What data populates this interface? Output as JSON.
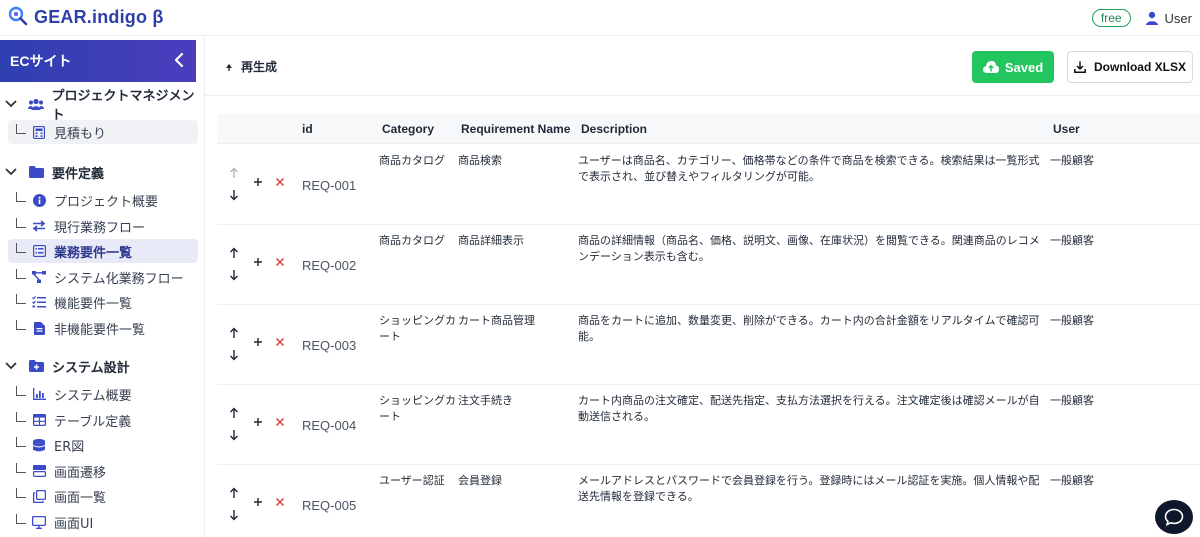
{
  "app": {
    "title": "GEAR.indigo β",
    "badge": "free",
    "user": "User"
  },
  "sidebar": {
    "title": "ECサイト",
    "sections": [
      {
        "label": "プロジェクトマネジメント",
        "icon": "users-icon",
        "items": [
          {
            "label": "見積もり",
            "icon": "calculator-icon"
          }
        ]
      },
      {
        "label": "要件定義",
        "icon": "folder-icon",
        "items": [
          {
            "label": "プロジェクト概要",
            "icon": "info-icon"
          },
          {
            "label": "現行業務フロー",
            "icon": "exchange-icon"
          },
          {
            "label": "業務要件一覧",
            "icon": "list-icon",
            "active": true
          },
          {
            "label": "システム化業務フロー",
            "icon": "flow-icon"
          },
          {
            "label": "機能要件一覧",
            "icon": "checklist-icon"
          },
          {
            "label": "非機能要件一覧",
            "icon": "file-icon"
          }
        ]
      },
      {
        "label": "システム設計",
        "icon": "folder-plus-icon",
        "items": [
          {
            "label": "システム概要",
            "icon": "chart-icon"
          },
          {
            "label": "テーブル定義",
            "icon": "table-icon"
          },
          {
            "label": "ER図",
            "icon": "database-icon"
          },
          {
            "label": "画面遷移",
            "icon": "screens-icon"
          },
          {
            "label": "画面一覧",
            "icon": "copy-icon"
          },
          {
            "label": "画面UI",
            "icon": "monitor-icon"
          }
        ]
      }
    ]
  },
  "toolbar": {
    "regenerate": "再生成",
    "saved": "Saved",
    "download": "Download XLSX"
  },
  "table": {
    "headers": {
      "id": "id",
      "category": "Category",
      "name": "Requirement Name",
      "description": "Description",
      "user": "User"
    },
    "rows": [
      {
        "id": "REQ-001",
        "category": "商品カタログ",
        "name": "商品検索",
        "description": "ユーザーは商品名、カテゴリー、価格帯などの条件で商品を検索できる。検索結果は一覧形式で表示され、並び替えやフィルタリングが可能。",
        "user": "一般顧客"
      },
      {
        "id": "REQ-002",
        "category": "商品カタログ",
        "name": "商品詳細表示",
        "description": "商品の詳細情報（商品名、価格、説明文、画像、在庫状況）を閲覧できる。関連商品のレコメンデーション表示も含む。",
        "user": "一般顧客"
      },
      {
        "id": "REQ-003",
        "category": "ショッピングカート",
        "name": "カート商品管理",
        "description": "商品をカートに追加、数量変更、削除ができる。カート内の合計金額をリアルタイムで確認可能。",
        "user": "一般顧客"
      },
      {
        "id": "REQ-004",
        "category": "ショッピングカート",
        "name": "注文手続き",
        "description": "カート内商品の注文確定、配送先指定、支払方法選択を行える。注文確定後は確認メールが自動送信される。",
        "user": "一般顧客"
      },
      {
        "id": "REQ-005",
        "category": "ユーザー認証",
        "name": "会員登録",
        "description": "メールアドレスとパスワードで会員登録を行う。登録時にはメール認証を実施。個人情報や配送先情報を登録できる。",
        "user": "一般顧客"
      }
    ]
  },
  "colors": {
    "brand": "#2f3fa8",
    "saved": "#22c55e",
    "delete": "#e53e3e"
  }
}
